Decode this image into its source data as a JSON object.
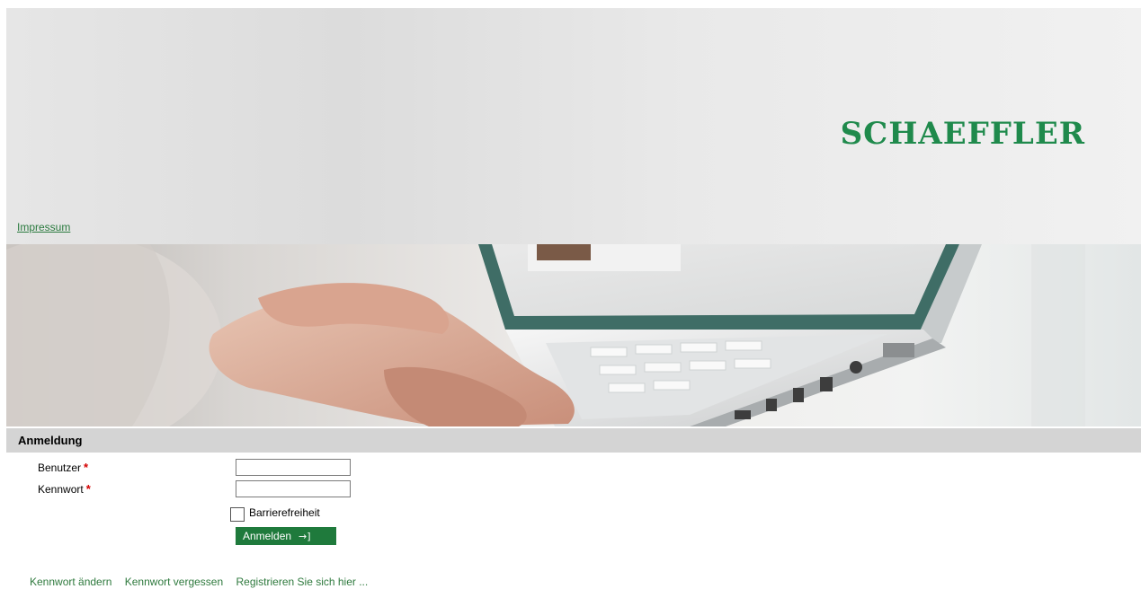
{
  "header": {
    "logo_text": "SCHAEFFLER",
    "impressum_link": "Impressum"
  },
  "login": {
    "section_title": "Anmeldung",
    "username_label": "Benutzer",
    "password_label": "Kennwort",
    "required_marker": "*",
    "username_value": "",
    "password_value": "",
    "accessibility_label": "Barrierefreiheit",
    "accessibility_checked": false,
    "submit_label": "Anmelden",
    "submit_icon_glyph": "→]"
  },
  "footer_links": {
    "change_password": "Kennwort ändern",
    "forgot_password": "Kennwort vergessen",
    "register": "Registrieren Sie sich hier ..."
  },
  "colors": {
    "brand_green": "#1f8a4c",
    "button_green": "#1f7a3c",
    "link_green": "#2f7a3e",
    "required_red": "#d40000",
    "section_bar_gray": "#d4d4d4"
  },
  "icons": {
    "submit_arrow": "login-arrow-icon"
  }
}
